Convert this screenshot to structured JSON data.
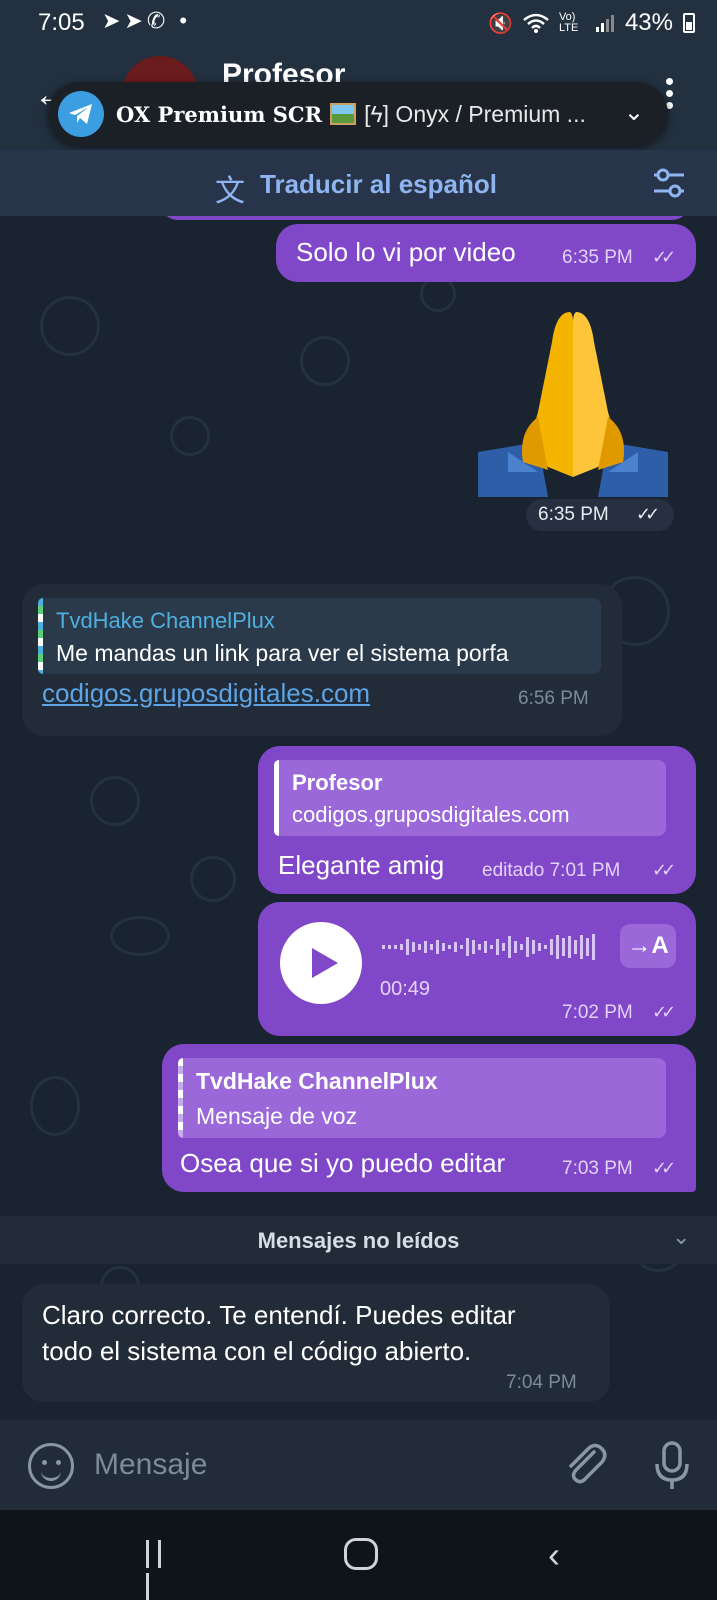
{
  "status_bar": {
    "time": "7:05",
    "left_icons": "➤➤✆ •",
    "volte": "Vo) LTE",
    "battery": "43%"
  },
  "header": {
    "contact_name": "Profesor"
  },
  "notification": {
    "title": "OX Premium SCR",
    "subtitle": "[ϟ] Onyx / Premium ..."
  },
  "translate": {
    "label": "Traducir al español"
  },
  "messages": [
    {
      "text": "Solo lo vi por video",
      "time": "6:35 PM",
      "direction": "out"
    },
    {
      "emoji": "🙏",
      "time": "6:35 PM",
      "direction": "out"
    },
    {
      "reply_to_author": "TvdHake ChannelPlux",
      "reply_to_text": "Me mandas un link para ver el sistema porfa",
      "link": "codigos.gruposdigitales.com",
      "time": "6:56 PM",
      "direction": "in"
    },
    {
      "reply_to_author": "Profesor",
      "reply_to_text": "codigos.gruposdigitales.com",
      "text": "Elegante amig",
      "edited_time": "editado 7:01 PM",
      "direction": "out"
    },
    {
      "voice_duration": "00:49",
      "transcribe_label": "→A",
      "time": "7:02 PM",
      "direction": "out"
    },
    {
      "reply_to_author": "TvdHake ChannelPlux",
      "reply_to_text": "Mensaje de voz",
      "text": "Osea que si yo puedo editar",
      "time": "7:03 PM",
      "direction": "out"
    },
    {
      "text_line1": "Claro correcto. Te entendí. Puedes editar",
      "text_line2": "todo el sistema con el código abierto.",
      "time": "7:04 PM",
      "direction": "in"
    }
  ],
  "unread_divider": {
    "label": "Mensajes no leídos"
  },
  "input": {
    "placeholder": "Mensaje"
  },
  "colors": {
    "outgoing_bubble": "#8048c8",
    "incoming_bubble": "#222c38",
    "link": "#5da4e6",
    "chat_background": "#1a2330"
  }
}
